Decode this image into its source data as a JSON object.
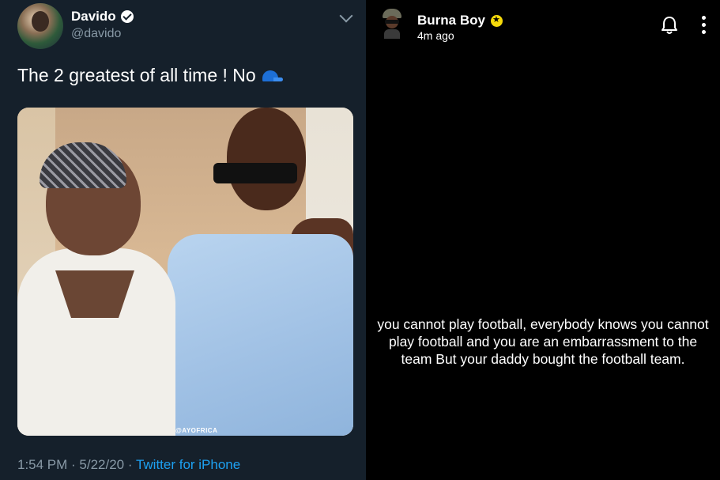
{
  "tweet": {
    "author_name": "Davido",
    "author_handle": "@davido",
    "text": "The 2 greatest of all time ! No",
    "emoji_icon": "blue-cap-icon",
    "image_watermark": "@AYOFRICA",
    "timestamp": "1:54 PM · 5/22/20 · ",
    "source": "Twitter for iPhone",
    "colors": {
      "background": "#15202b",
      "secondary_text": "#8899a6",
      "link": "#1da1f2"
    }
  },
  "story": {
    "user_name": "Burna Boy",
    "time_ago": "4m ago",
    "caption": "you cannot play football, everybody knows you cannot play football and you are an embarrassment to the team But your daddy bought the football team.",
    "icons": [
      "bell-icon",
      "more-vertical-icon"
    ],
    "colors": {
      "background": "#000000",
      "badge": "#f5d90a"
    }
  }
}
